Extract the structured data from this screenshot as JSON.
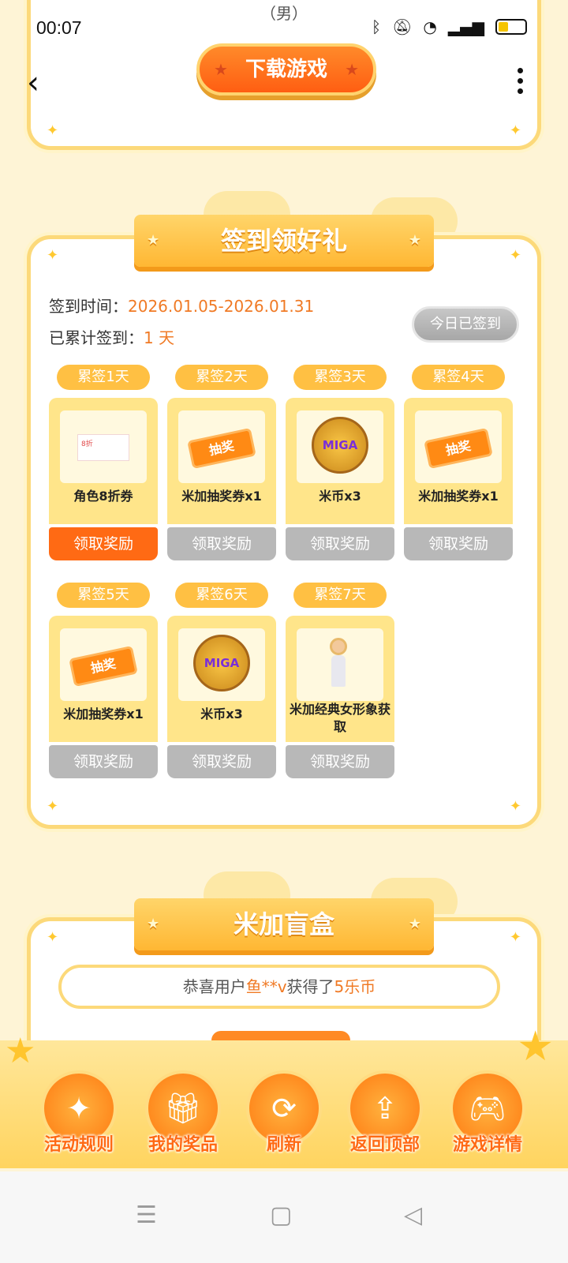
{
  "status_bar": {
    "time": "00:07"
  },
  "top_card": {
    "gender_text": "（男）",
    "download_label": "下载游戏"
  },
  "sign_in": {
    "title": "签到领好礼",
    "period_label": "签到时间：",
    "period_value": "2026.01.05-2026.01.31",
    "total_label": "已累计签到：",
    "total_value": "1 天",
    "today_button": "今日已签到",
    "days": [
      {
        "tag": "累签1天",
        "name": "角色8折券",
        "claim": "领取奖励",
        "state": "active",
        "icon": "coupon-icon"
      },
      {
        "tag": "累签2天",
        "name": "米加抽奖券x1",
        "claim": "领取奖励",
        "state": "disabled",
        "icon": "lottery-ticket-icon"
      },
      {
        "tag": "累签3天",
        "name": "米币x3",
        "claim": "领取奖励",
        "state": "disabled",
        "icon": "miga-coin-icon"
      },
      {
        "tag": "累签4天",
        "name": "米加抽奖券x1",
        "claim": "领取奖励",
        "state": "disabled",
        "icon": "lottery-ticket-icon"
      },
      {
        "tag": "累签5天",
        "name": "米加抽奖券x1",
        "claim": "领取奖励",
        "state": "disabled",
        "icon": "lottery-ticket-icon"
      },
      {
        "tag": "累签6天",
        "name": "米币x3",
        "claim": "领取奖励",
        "state": "disabled",
        "icon": "miga-coin-icon"
      },
      {
        "tag": "累签7天",
        "name": "米加经典女形象获取",
        "claim": "领取奖励",
        "state": "disabled",
        "icon": "avatar-figure-icon"
      }
    ],
    "ticket_text": "抽奖",
    "coin_text": "MIGA",
    "coupon_text": "8折"
  },
  "blind_box": {
    "title": "米加盲盒",
    "marquee_prefix": "恭喜用户",
    "marquee_user": "鱼**v",
    "marquee_mid": "获得了",
    "marquee_prize": "5乐币"
  },
  "dock": [
    {
      "label": "活动规则",
      "icon": "rules-icon"
    },
    {
      "label": "我的奖品",
      "icon": "gift-icon"
    },
    {
      "label": "刷新",
      "icon": "refresh-icon"
    },
    {
      "label": "返回顶部",
      "icon": "back-to-top-icon"
    },
    {
      "label": "游戏详情",
      "icon": "gamepad-icon"
    }
  ],
  "colors": {
    "accent": "#ff6a14",
    "highlight": "#f07a25",
    "border": "#fcd97a",
    "background": "#fef4d6"
  }
}
